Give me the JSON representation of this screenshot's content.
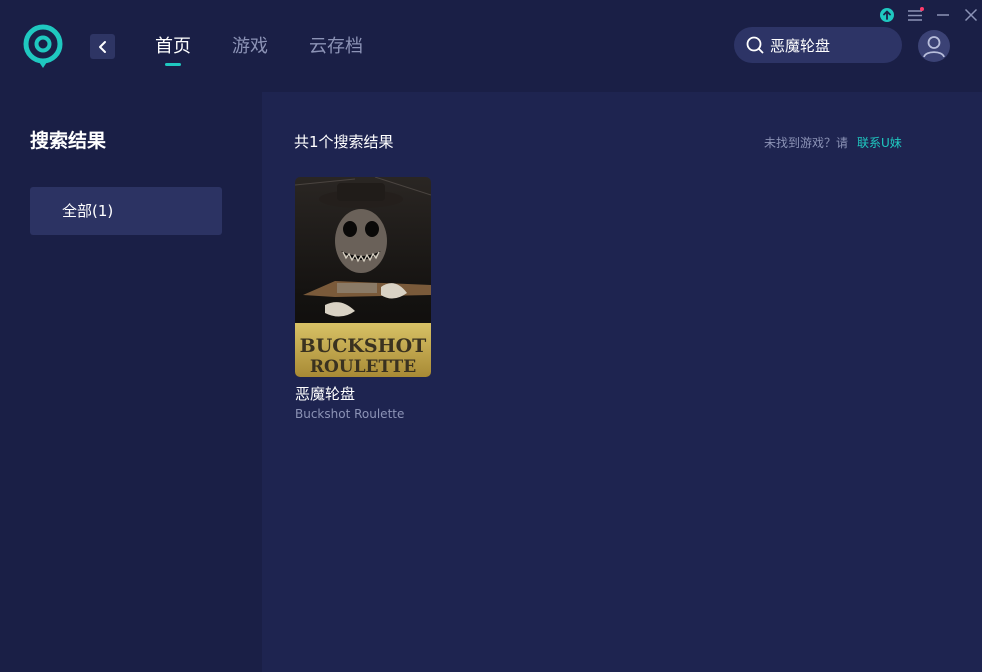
{
  "header": {
    "nav": [
      {
        "label": "首页",
        "active": true
      },
      {
        "label": "游戏",
        "active": false
      },
      {
        "label": "云存档",
        "active": false
      }
    ],
    "search": {
      "value": "恶魔轮盘"
    },
    "icons": {
      "logo": "app-logo",
      "back": "chevron-left-icon",
      "upgrade": "upgrade-icon",
      "menu": "menu-icon",
      "minimize": "minimize-icon",
      "close": "close-icon",
      "avatar": "user-icon"
    },
    "accent": "#1fc8c0"
  },
  "sidebar": {
    "title": "搜索结果",
    "filters": [
      {
        "label": "全部(1)"
      }
    ]
  },
  "main": {
    "result_count": "共1个搜索结果",
    "not_found_text": "未找到游戏？请",
    "contact_link": "联系U妹",
    "games": [
      {
        "title": "恶魔轮盘",
        "subtitle": "Buckshot Roulette",
        "cover_text_line1": "BUCKSHOT",
        "cover_text_line2": "ROULETTE"
      }
    ]
  }
}
